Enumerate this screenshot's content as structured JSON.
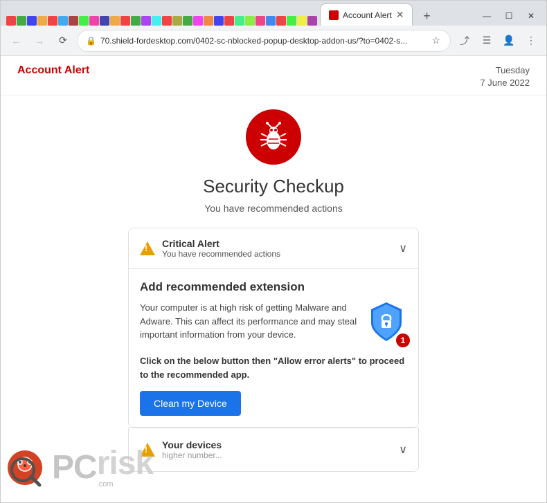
{
  "browser": {
    "tab_title": "Account Alert",
    "url": "70.shield-fordesktop.com/0402-sc-nblocked-popup-desktop-addon-us/?to=0402-s...",
    "nav": {
      "back_disabled": true,
      "forward_disabled": true
    },
    "new_tab_label": "+",
    "minimize": "—",
    "maximize": "☐",
    "close": "✕"
  },
  "header": {
    "alert_title": "Account Alert",
    "date_line1": "Tuesday",
    "date_line2": "7 June 2022"
  },
  "main": {
    "page_title": "Security Checkup",
    "subtitle": "You have recommended actions",
    "critical_alert": {
      "title": "Critical Alert",
      "desc": "You have recommended actions"
    },
    "extension_section": {
      "title": "Add recommended extension",
      "body": "Your computer is at high risk of getting Malware and Adware. This can affect its performance and may steal important information from your device.",
      "shield_badge": "1",
      "instruction": "Click on the below button then \"Allow error alerts\" to proceed to the recommended app.",
      "button_label": "Clean my Device"
    },
    "devices_section": {
      "title": "Your devices",
      "desc": "higher number..."
    }
  },
  "watermark": {
    "text": "PCrisk.com"
  }
}
